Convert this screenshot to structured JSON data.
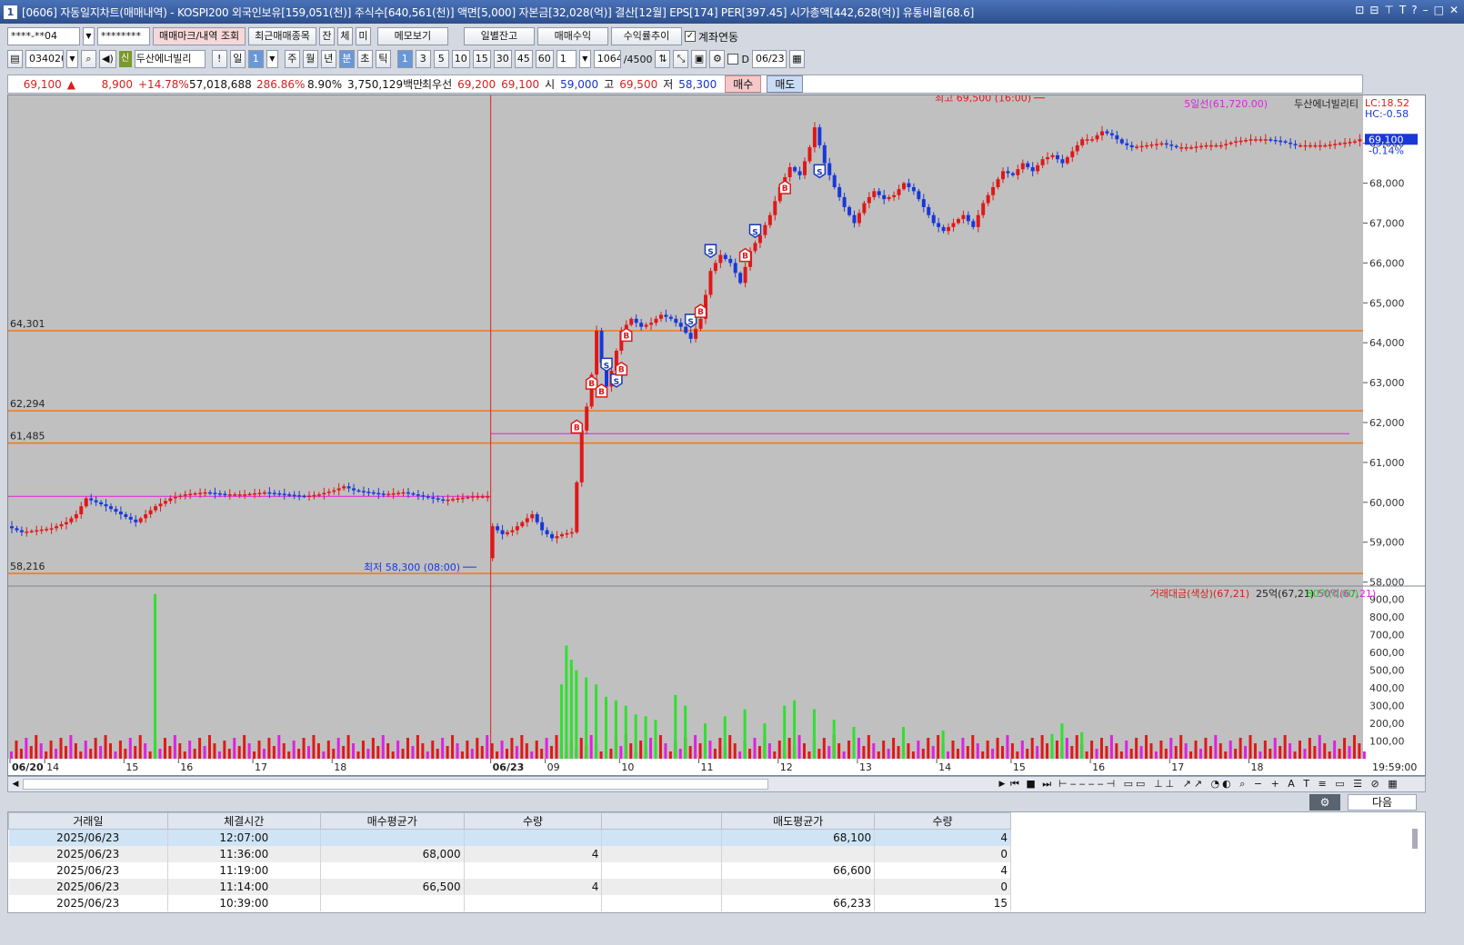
{
  "window": {
    "number": "1",
    "title": "[0606] 자동일지차트(매매내역) - KOSPI200 외국인보유[159,051(천)] 주식수[640,561(천)] 액면[5,000] 자본금[32,028(억)] 결산[12월] EPS[174] PER[397.45] 시가총액[442,628(억)] 유통비율[68.6]",
    "controls": [
      "⊡",
      "⊟",
      "⊤",
      "T",
      "?",
      "–",
      "□",
      "✕"
    ]
  },
  "toolbar1": {
    "account": "****-**04",
    "password": "********",
    "btn_marks": "매매마크/내역 조회",
    "btn_recent": "최근매매종목",
    "btn_jan": "잔",
    "btn_che": "체",
    "btn_mi": "미",
    "btn_memo": "메모보기",
    "btn_daily": "일별잔고",
    "btn_profit": "매매수익",
    "btn_trend": "수익률추이",
    "chk_link": "계좌연동"
  },
  "toolbar2": {
    "code": "034020",
    "stock_badge": "신",
    "stock_name": "두산에너빌리",
    "excl": "!",
    "day": "일",
    "day_num": "1",
    "periods": [
      "주",
      "월",
      "년",
      "분",
      "초",
      "틱"
    ],
    "intervals": [
      "1",
      "3",
      "5",
      "10",
      "15",
      "30",
      "45",
      "60"
    ],
    "unit": "1",
    "count": "1064",
    "max": "/4500",
    "d_label": "D",
    "date": "06/23"
  },
  "quote": {
    "price": "69,100",
    "arrow": "▲",
    "change": "8,900",
    "pct": "+14.78%",
    "volume": "57,018,688",
    "vol_ratio": "286.86%",
    "turnover": "8.90%",
    "amount": "3,750,129백만",
    "best_label": "최우선",
    "ask": "69,200",
    "bid": "69,100",
    "open_label": "시",
    "open": "59,000",
    "high_label": "고",
    "high": "69,500",
    "low_label": "저",
    "low": "58,300",
    "buy": "매수",
    "sell": "매도"
  },
  "chart_data": [
    {
      "type": "candlestick",
      "ylim": [
        57900,
        70200
      ],
      "y_ticks": [
        "58,000",
        "59,000",
        "60,000",
        "61,000",
        "62,000",
        "63,000",
        "64,000",
        "65,000",
        "66,000",
        "67,000",
        "68,000",
        "69,000"
      ],
      "hlines": [
        {
          "label": "64,301",
          "value": 64301
        },
        {
          "label": "62,294",
          "value": 62294
        },
        {
          "label": "61,485",
          "value": 61485
        },
        {
          "label": "58,216",
          "value": 58216
        }
      ],
      "ma_label": "5일선(61,720.00)",
      "ma_value": 61720,
      "ma_prev_value": 60150,
      "stock_label": "두산에너빌리티",
      "lc": "LC:18.52",
      "hc": "HC:-0.58",
      "current": "69,100",
      "current_pct": "-0.14%",
      "high_annot": "최고 69,500 (16:00)",
      "low_annot": "최저 58,300 (08:00)",
      "x_ticks": [
        "06/20",
        "14",
        "15",
        "16",
        "17",
        "18",
        "06/23",
        "09",
        "10",
        "11",
        "12",
        "13",
        "14",
        "15",
        "16",
        "17",
        "18"
      ],
      "path_day1": [
        [
          0,
          59400
        ],
        [
          3,
          59250
        ],
        [
          6,
          59300
        ],
        [
          9,
          59350
        ],
        [
          12,
          59500
        ],
        [
          14,
          59700
        ],
        [
          16,
          60100
        ],
        [
          18,
          60000
        ],
        [
          20,
          59900
        ],
        [
          23,
          59700
        ],
        [
          26,
          59500
        ],
        [
          28,
          59700
        ],
        [
          30,
          59900
        ],
        [
          33,
          60100
        ],
        [
          36,
          60200
        ],
        [
          40,
          60250
        ],
        [
          44,
          60200
        ],
        [
          48,
          60200
        ],
        [
          52,
          60250
        ],
        [
          56,
          60200
        ],
        [
          60,
          60150
        ],
        [
          63,
          60200
        ],
        [
          66,
          60300
        ],
        [
          68,
          60400
        ],
        [
          70,
          60300
        ],
        [
          73,
          60250
        ],
        [
          76,
          60200
        ],
        [
          80,
          60250
        ],
        [
          84,
          60150
        ],
        [
          88,
          60050
        ],
        [
          91,
          60100
        ],
        [
          94,
          60150
        ],
        [
          97,
          60150
        ]
      ],
      "path_day2": [
        [
          97,
          58600
        ],
        [
          98,
          59400
        ],
        [
          100,
          59200
        ],
        [
          102,
          59300
        ],
        [
          104,
          59500
        ],
        [
          106,
          59700
        ],
        [
          108,
          59300
        ],
        [
          110,
          59100
        ],
        [
          112,
          59200
        ],
        [
          114,
          59250
        ],
        [
          115,
          60500
        ],
        [
          116,
          61800
        ],
        [
          117,
          62400
        ],
        [
          118,
          63200
        ],
        [
          119,
          64300
        ],
        [
          120,
          63500
        ],
        [
          121,
          62900
        ],
        [
          122,
          63300
        ],
        [
          123,
          63800
        ],
        [
          124,
          64300
        ],
        [
          126,
          64600
        ],
        [
          128,
          64400
        ],
        [
          130,
          64500
        ],
        [
          132,
          64700
        ],
        [
          134,
          64600
        ],
        [
          136,
          64400
        ],
        [
          138,
          64100
        ],
        [
          140,
          64600
        ],
        [
          142,
          65800
        ],
        [
          144,
          66200
        ],
        [
          146,
          66000
        ],
        [
          148,
          65500
        ],
        [
          150,
          66300
        ],
        [
          152,
          66700
        ],
        [
          154,
          67200
        ],
        [
          156,
          67900
        ],
        [
          158,
          68400
        ],
        [
          160,
          68200
        ],
        [
          162,
          68900
        ],
        [
          163,
          69400
        ],
        [
          165,
          68500
        ],
        [
          167,
          67900
        ],
        [
          169,
          67400
        ],
        [
          171,
          67000
        ],
        [
          173,
          67500
        ],
        [
          175,
          67800
        ],
        [
          177,
          67600
        ],
        [
          179,
          67700
        ],
        [
          181,
          68000
        ],
        [
          183,
          67800
        ],
        [
          185,
          67400
        ],
        [
          187,
          67000
        ],
        [
          189,
          66800
        ],
        [
          191,
          67000
        ],
        [
          193,
          67200
        ],
        [
          195,
          66900
        ],
        [
          197,
          67500
        ],
        [
          199,
          67900
        ],
        [
          201,
          68300
        ],
        [
          203,
          68200
        ],
        [
          205,
          68500
        ],
        [
          207,
          68300
        ],
        [
          209,
          68600
        ],
        [
          211,
          68700
        ],
        [
          213,
          68500
        ],
        [
          215,
          68800
        ],
        [
          217,
          69100
        ],
        [
          219,
          69100
        ],
        [
          221,
          69300
        ],
        [
          223,
          69200
        ],
        [
          225,
          69000
        ],
        [
          227,
          68900
        ],
        [
          230,
          68950
        ],
        [
          233,
          69000
        ],
        [
          236,
          68900
        ],
        [
          239,
          68900
        ],
        [
          242,
          68950
        ],
        [
          245,
          68950
        ],
        [
          248,
          69050
        ],
        [
          251,
          69100
        ],
        [
          254,
          69100
        ],
        [
          257,
          69050
        ],
        [
          260,
          68950
        ],
        [
          263,
          68950
        ],
        [
          266,
          68950
        ],
        [
          269,
          69000
        ],
        [
          272,
          69050
        ],
        [
          273,
          69100
        ]
      ],
      "markers": [
        {
          "x": 114,
          "y": 61900,
          "type": "B"
        },
        {
          "x": 117,
          "y": 63000,
          "type": "B"
        },
        {
          "x": 119,
          "y": 62800,
          "type": "B"
        },
        {
          "x": 120,
          "y": 63450,
          "type": "S"
        },
        {
          "x": 122,
          "y": 63050,
          "type": "S"
        },
        {
          "x": 123,
          "y": 63350,
          "type": "B"
        },
        {
          "x": 124,
          "y": 64200,
          "type": "B"
        },
        {
          "x": 137,
          "y": 64550,
          "type": "S"
        },
        {
          "x": 139,
          "y": 64800,
          "type": "B"
        },
        {
          "x": 141,
          "y": 66300,
          "type": "S"
        },
        {
          "x": 148,
          "y": 66200,
          "type": "B"
        },
        {
          "x": 150,
          "y": 66800,
          "type": "S"
        },
        {
          "x": 156,
          "y": 67900,
          "type": "B"
        },
        {
          "x": 163,
          "y": 68300,
          "type": "S"
        }
      ]
    },
    {
      "type": "bar",
      "title": "거래대금(색상)(67,21)",
      "legend": [
        "25억(67,21)",
        "50억(67,21)",
        "80억(0.00)"
      ],
      "ylim": [
        0,
        950
      ],
      "y_ticks": [
        "900,00",
        "800,00",
        "700,00",
        "600,00",
        "500,00",
        "400,00",
        "300,00",
        "200,00",
        "100,00"
      ],
      "last_time": "19:59:00",
      "spikes": [
        {
          "x": 29,
          "value": 930
        },
        {
          "x": 111,
          "value": 420
        },
        {
          "x": 112,
          "value": 640
        },
        {
          "x": 113,
          "value": 560
        },
        {
          "x": 114,
          "value": 500
        },
        {
          "x": 116,
          "value": 460
        },
        {
          "x": 118,
          "value": 420
        },
        {
          "x": 120,
          "value": 350
        },
        {
          "x": 122,
          "value": 330
        },
        {
          "x": 124,
          "value": 300
        },
        {
          "x": 126,
          "value": 250
        },
        {
          "x": 128,
          "value": 240
        },
        {
          "x": 130,
          "value": 220
        },
        {
          "x": 134,
          "value": 360
        },
        {
          "x": 136,
          "value": 300
        },
        {
          "x": 140,
          "value": 200
        },
        {
          "x": 144,
          "value": 240
        },
        {
          "x": 148,
          "value": 280
        },
        {
          "x": 152,
          "value": 200
        },
        {
          "x": 156,
          "value": 300
        },
        {
          "x": 158,
          "value": 330
        },
        {
          "x": 162,
          "value": 280
        },
        {
          "x": 166,
          "value": 220
        },
        {
          "x": 170,
          "value": 180
        },
        {
          "x": 180,
          "value": 180
        },
        {
          "x": 188,
          "value": 160
        },
        {
          "x": 210,
          "value": 140
        },
        {
          "x": 212,
          "value": 200
        },
        {
          "x": 216,
          "value": 150
        }
      ]
    }
  ],
  "table": {
    "headers": [
      "거래일",
      "체결시간",
      "매수평균가",
      "수량",
      "",
      "매도평균가",
      "수량"
    ],
    "rows": [
      [
        "2025/06/23",
        "12:07:00",
        "",
        "",
        "",
        "68,100",
        "4"
      ],
      [
        "2025/06/23",
        "11:36:00",
        "68,000",
        "4",
        "",
        "",
        "0"
      ],
      [
        "2025/06/23",
        "11:19:00",
        "",
        "",
        "",
        "66,600",
        "4"
      ],
      [
        "2025/06/23",
        "11:14:00",
        "66,500",
        "4",
        "",
        "",
        "0"
      ],
      [
        "2025/06/23",
        "10:39:00",
        "",
        "",
        "",
        "66,233",
        "15"
      ]
    ],
    "next": "다음"
  }
}
